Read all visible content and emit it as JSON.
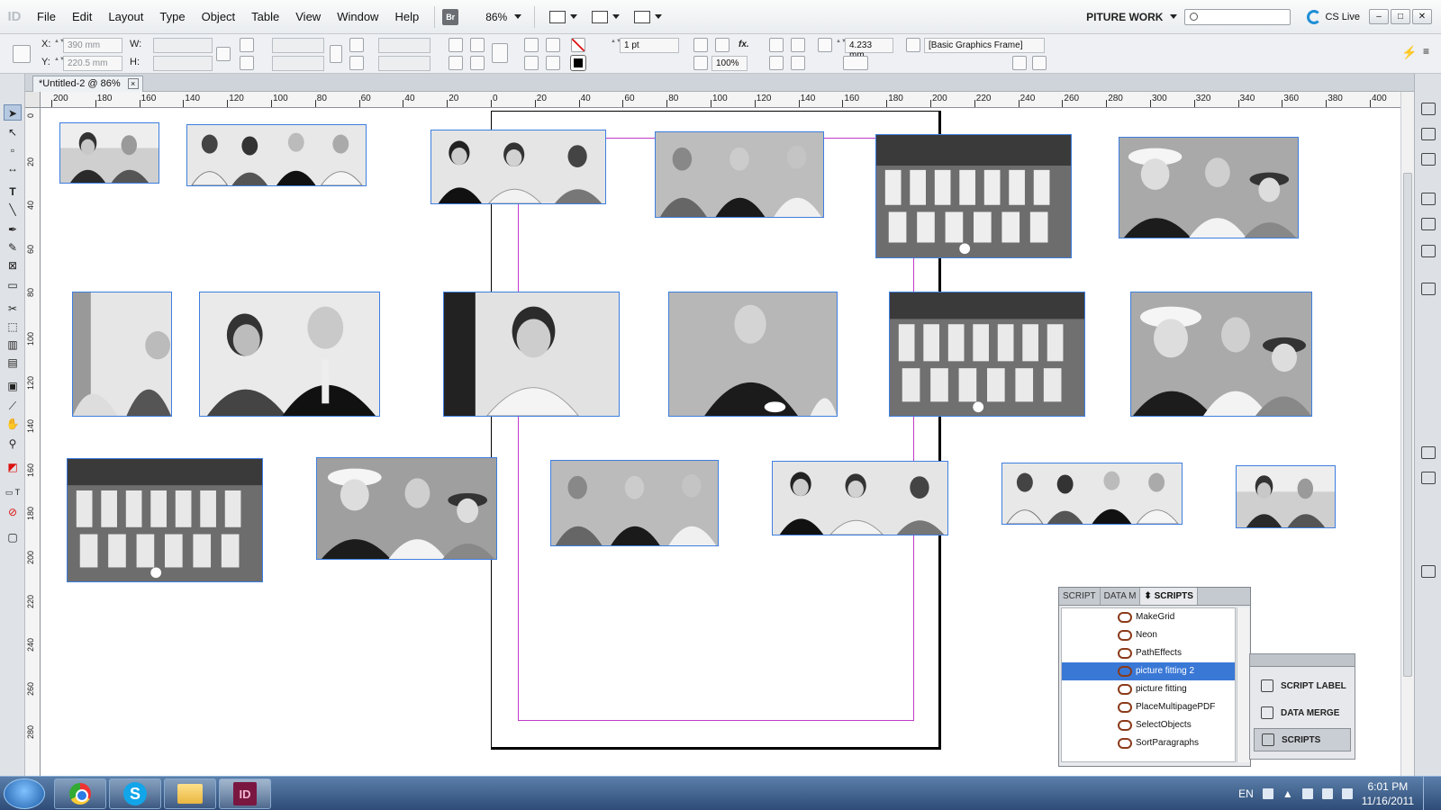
{
  "menubar": {
    "logo": "ID",
    "items": [
      "File",
      "Edit",
      "Layout",
      "Type",
      "Object",
      "Table",
      "View",
      "Window",
      "Help"
    ],
    "bridge_label": "Br",
    "zoom": "86%",
    "workspace": "PITURE WORK",
    "cs_live": "CS Live"
  },
  "controlbar": {
    "x_label": "X:",
    "x_value": "390 mm",
    "y_label": "Y:",
    "y_value": "220.5 mm",
    "w_label": "W:",
    "h_label": "H:",
    "stroke_weight": "1 pt",
    "gap_value": "4.233 mm",
    "opacity": "100%",
    "object_style": "[Basic Graphics Frame]"
  },
  "document": {
    "tab_title": "*Untitled-2 @ 86%",
    "close_glyph": "×"
  },
  "ruler": {
    "top_ticks": [
      "200",
      "180",
      "160",
      "140",
      "120",
      "100",
      "80",
      "60",
      "40",
      "20",
      "0",
      "20",
      "40",
      "60",
      "80",
      "100",
      "120",
      "140",
      "160",
      "180",
      "200",
      "220",
      "240",
      "260",
      "280",
      "300",
      "320",
      "340",
      "360",
      "380",
      "400"
    ],
    "left_ticks": [
      "0",
      "20",
      "40",
      "60",
      "80",
      "100",
      "120",
      "140",
      "160",
      "180",
      "200",
      "220",
      "240",
      "260",
      "280"
    ]
  },
  "scripts_panel": {
    "tabs": [
      "SCRIPT",
      "DATA M",
      "⬍ SCRIPTS"
    ],
    "items": [
      {
        "label": "MakeGrid",
        "selected": false
      },
      {
        "label": "Neon",
        "selected": false
      },
      {
        "label": "PathEffects",
        "selected": false
      },
      {
        "label": "picture fitting 2",
        "selected": true
      },
      {
        "label": "picture fitting",
        "selected": false
      },
      {
        "label": "PlaceMultipagePDF",
        "selected": false
      },
      {
        "label": "SelectObjects",
        "selected": false
      },
      {
        "label": "SortParagraphs",
        "selected": false
      }
    ]
  },
  "mini_panel": {
    "items": [
      {
        "label": "SCRIPT LABEL",
        "active": false
      },
      {
        "label": "DATA MERGE",
        "active": false
      },
      {
        "label": "SCRIPTS",
        "active": true
      }
    ]
  },
  "taskbar": {
    "apps": [
      "chrome-icon",
      "skype-icon",
      "folder-icon",
      "indesign-icon"
    ],
    "indesign_label": "ID",
    "skype_label": "S",
    "language": "EN",
    "time": "6:01 PM",
    "date": "11/16/2011"
  }
}
